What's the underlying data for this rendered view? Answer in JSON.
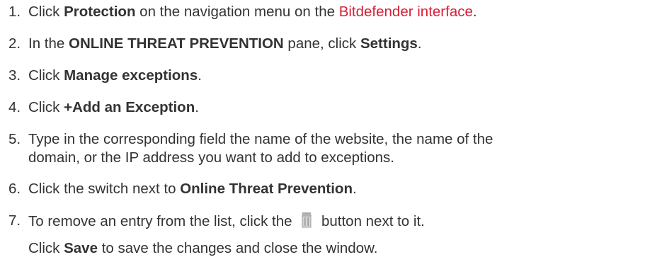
{
  "steps": [
    {
      "num": "1.",
      "pre": "Click ",
      "bold": "Protection",
      "mid": " on the navigation menu on the ",
      "link": "Bitdefender interface",
      "post": "."
    },
    {
      "num": "2.",
      "pre": "In the ",
      "bold1": "ONLINE THREAT PREVENTION",
      "mid": " pane, click ",
      "bold2": "Settings",
      "post": "."
    },
    {
      "num": "3.",
      "pre": "Click ",
      "bold": "Manage exceptions",
      "post": "."
    },
    {
      "num": "4.",
      "pre": "Click ",
      "bold": "+Add an Exception",
      "post": "."
    },
    {
      "num": "5.",
      "line1": "Type in the corresponding field the name of the website, the name of the",
      "line2": "domain, or the IP address you want to add to exceptions."
    },
    {
      "num": "6.",
      "pre": "Click the switch next to ",
      "bold": "Online Threat Prevention",
      "post": "."
    },
    {
      "num": "7.",
      "pre": "To remove an entry from the list, click the",
      "icon": "trash-icon",
      "post": "button next to it."
    }
  ],
  "note": {
    "pre": "Click ",
    "bold": "Save",
    "post": " to save the changes and close the window."
  }
}
